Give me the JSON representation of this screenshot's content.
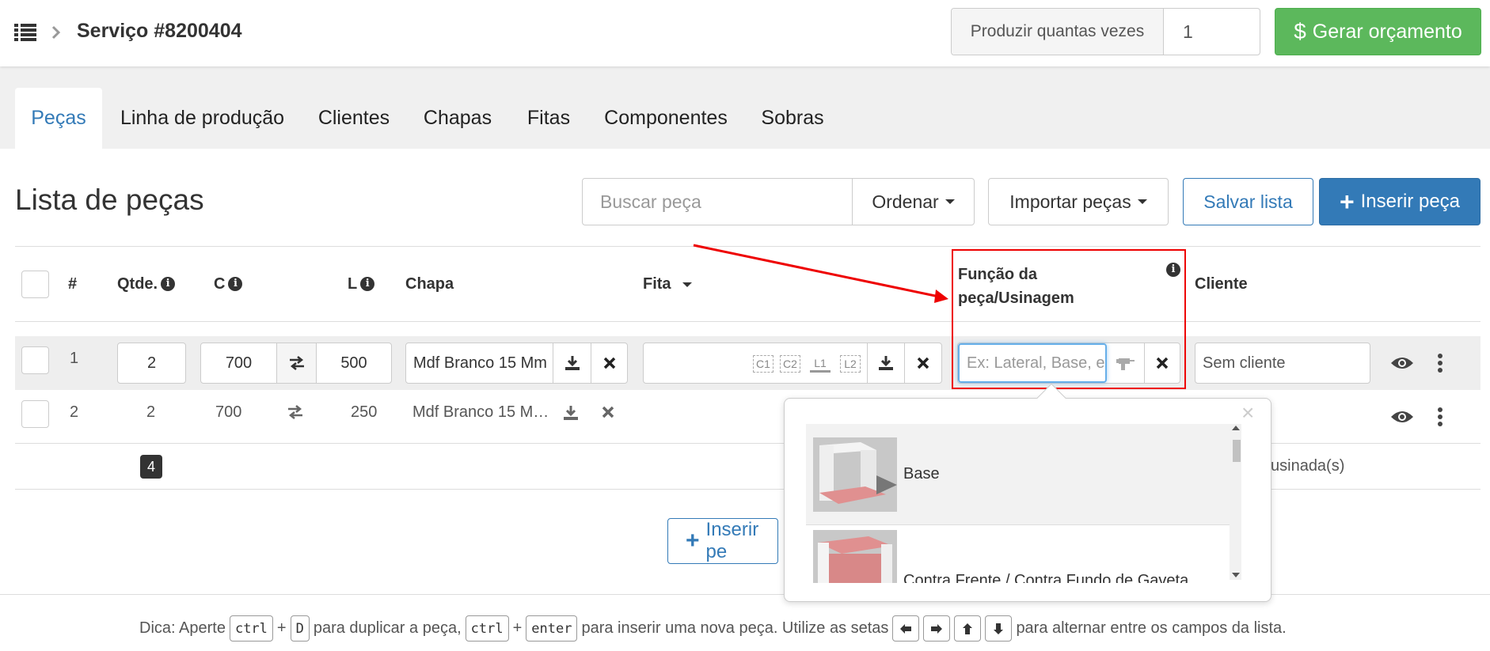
{
  "header": {
    "title": "Serviço #8200404",
    "produce_label": "Produzir quantas vezes",
    "produce_value": "1",
    "budget_label": "Gerar orçamento",
    "budget_icon": "$"
  },
  "tabs": [
    {
      "label": "Peças",
      "active": true
    },
    {
      "label": "Linha de produção"
    },
    {
      "label": "Clientes"
    },
    {
      "label": "Chapas"
    },
    {
      "label": "Fitas"
    },
    {
      "label": "Componentes"
    },
    {
      "label": "Sobras"
    }
  ],
  "list": {
    "title": "Lista de peças",
    "search_placeholder": "Buscar peça",
    "order_label": "Ordenar",
    "import_label": "Importar peças",
    "save_label": "Salvar lista",
    "insert_label": "Inserir peça",
    "insert_bottom_label": "Inserir pe"
  },
  "table": {
    "columns": {
      "num": "#",
      "qty": "Qtde.",
      "c": "C",
      "l": "L",
      "chapa": "Chapa",
      "fita": "Fita",
      "funcao_1": "Função da",
      "funcao_2": "peça/Usinagem",
      "cliente": "Cliente"
    },
    "rows": [
      {
        "num": "1",
        "qty": "2",
        "c": "700",
        "l": "500",
        "chapa": "Mdf Branco 15 Mm",
        "funcao_placeholder": "Ex: Lateral, Base, e",
        "cliente": "Sem cliente"
      },
      {
        "num": "2",
        "qty": "2",
        "c": "700",
        "l": "250",
        "chapa": "Mdf Branco 15 M…"
      }
    ],
    "edge_labels": [
      "C1",
      "C2",
      "L1",
      "L2"
    ],
    "total_qty": "4",
    "usinada_text": "usinada(s)"
  },
  "popup": {
    "options": [
      {
        "label": "Base"
      },
      {
        "label": "Contra Frente / Contra Fundo de Gaveta"
      }
    ],
    "close_icon": "×"
  },
  "tip": {
    "prefix": "Dica: Aperte",
    "ctrl": "ctrl",
    "plus": "+",
    "key_d": "D",
    "dup_text": "para duplicar a peça,",
    "enter": "enter",
    "new_text": "para inserir uma nova peça. Utilize as setas",
    "end_text": "para alternar entre os campos da lista."
  },
  "colors": {
    "primary": "#337ab7",
    "success": "#5cb85c",
    "highlight": "#ee0000"
  }
}
